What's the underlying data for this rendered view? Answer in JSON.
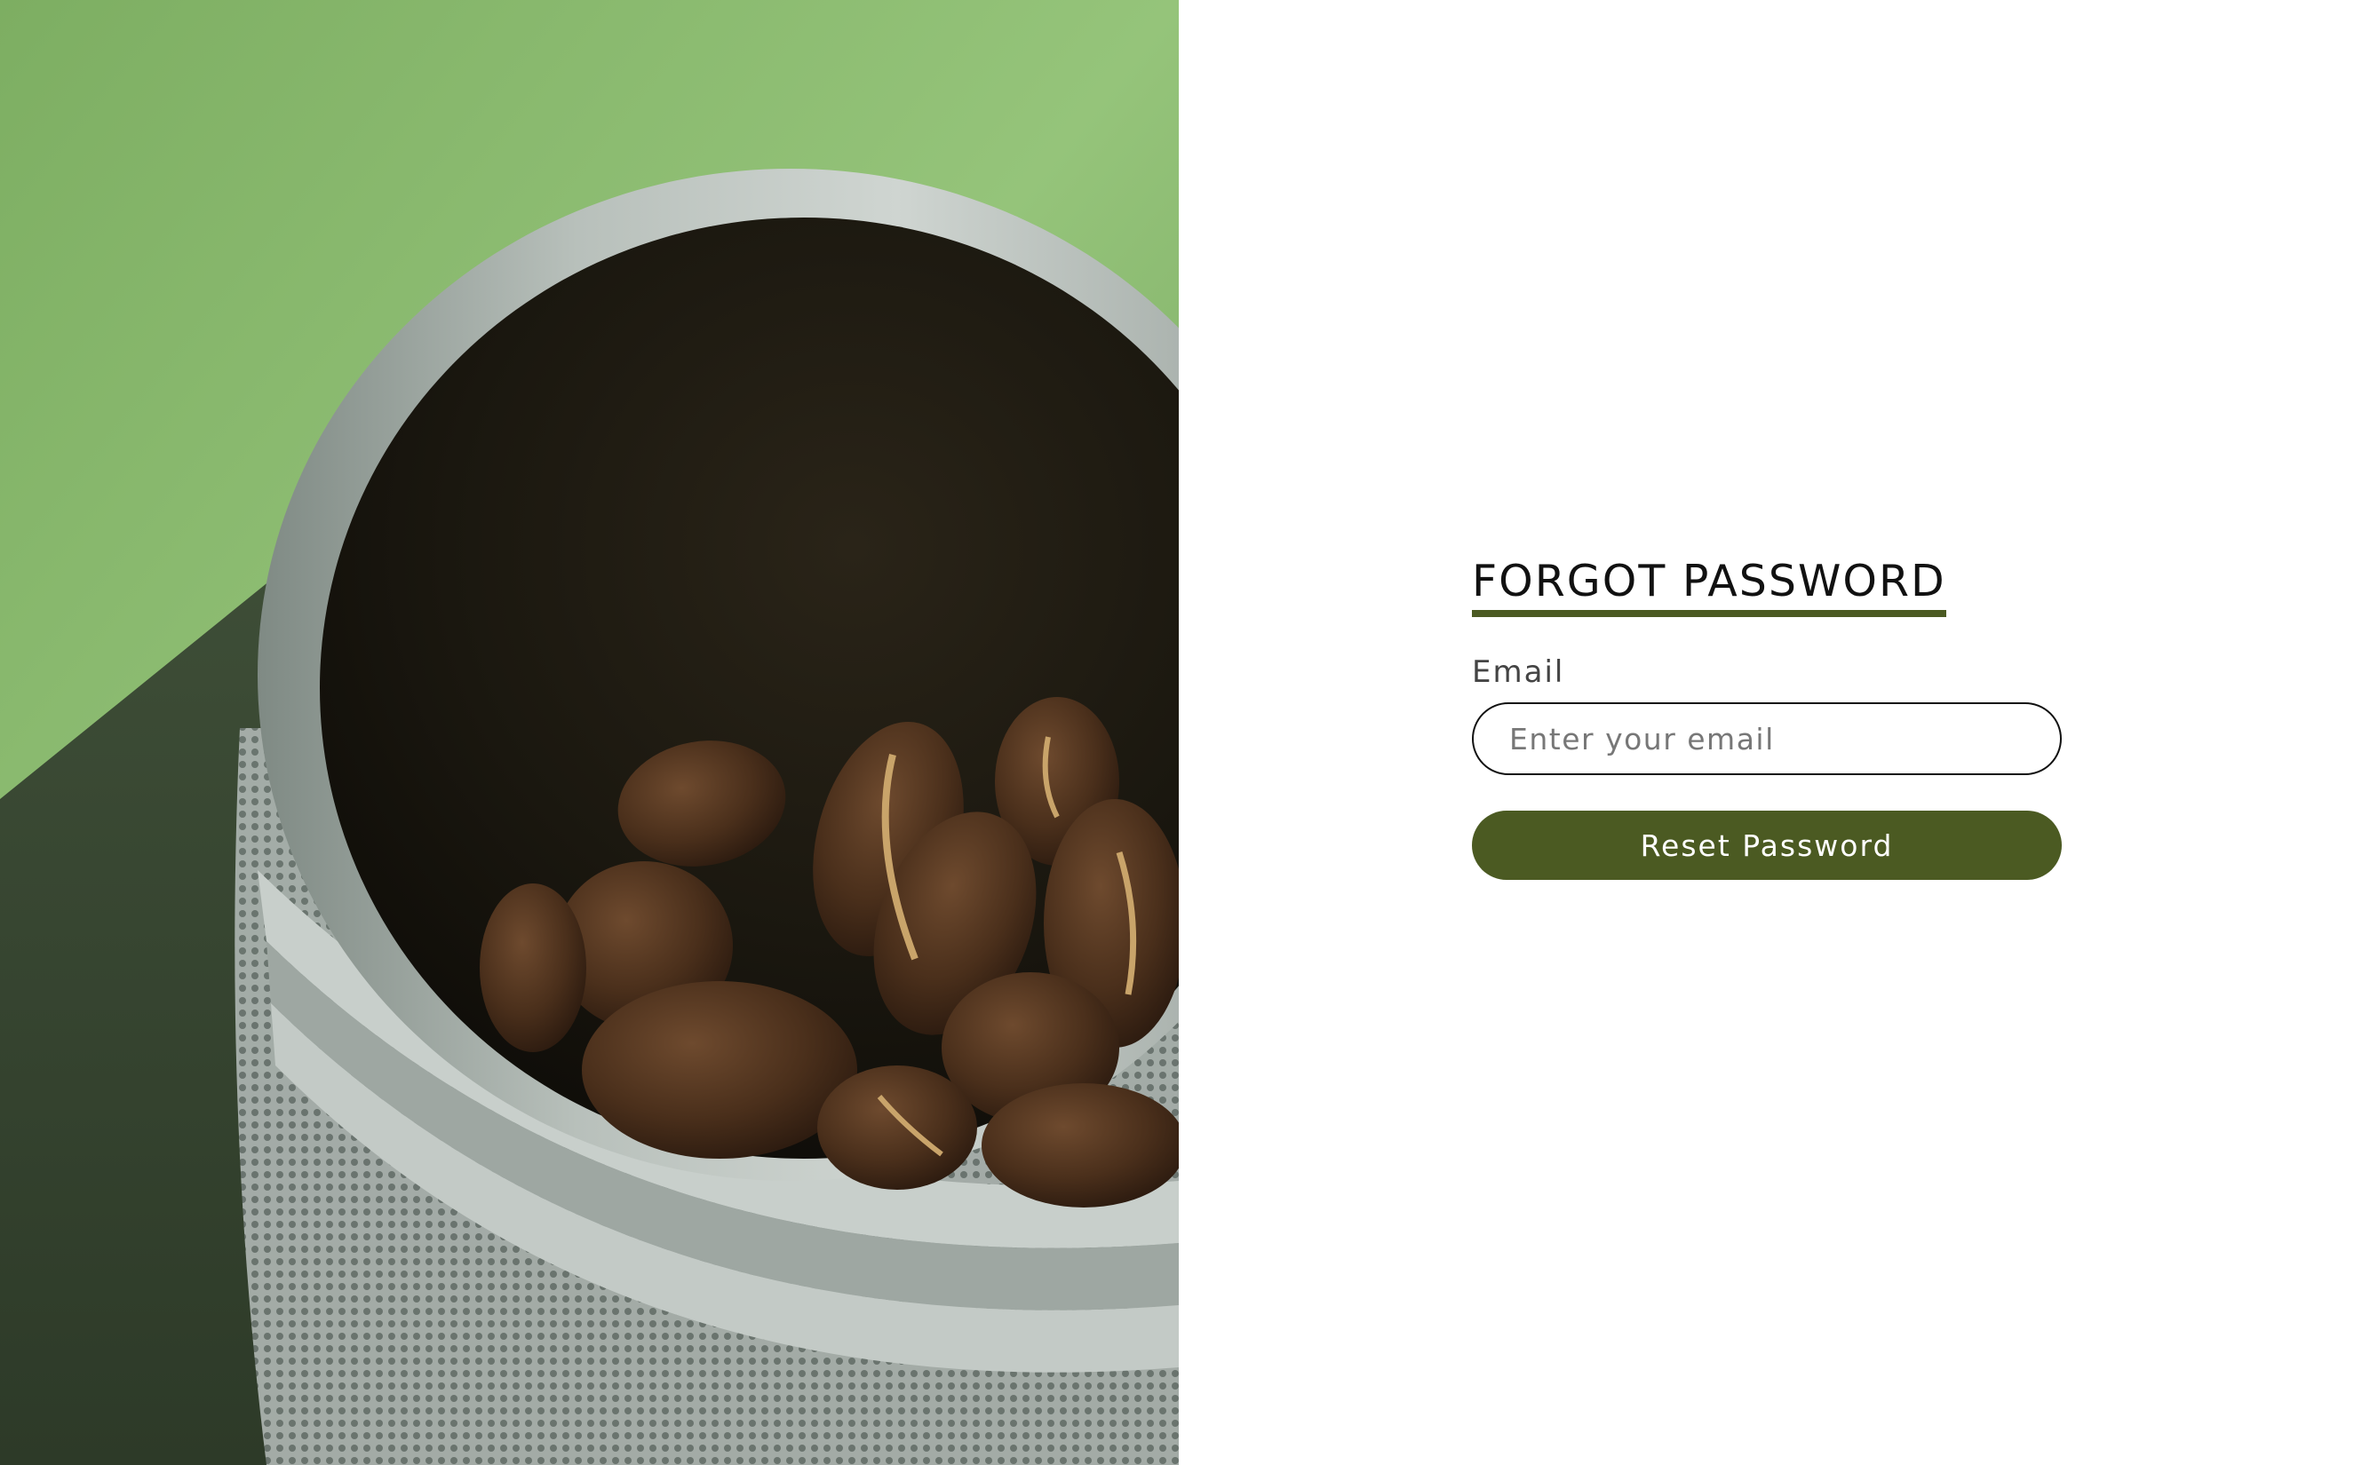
{
  "hero": {
    "image_name": "coffee-beans-grinder-photo"
  },
  "form": {
    "title": "FORGOT PASSWORD",
    "email_label": "Email",
    "email_placeholder": "Enter your email",
    "email_value": "",
    "submit_label": "Reset Password"
  },
  "colors": {
    "accent": "#4b5a22",
    "background": "#ffffff",
    "text": "#111111"
  }
}
